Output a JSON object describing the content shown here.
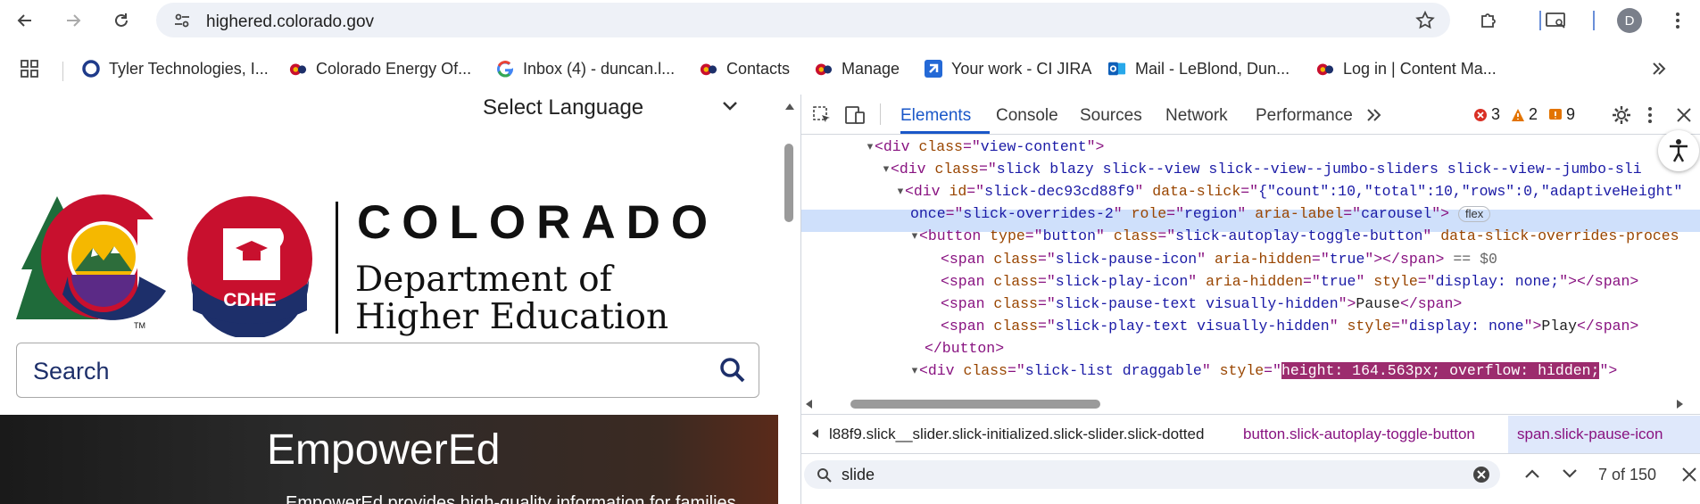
{
  "browser": {
    "url": "highered.colorado.gov",
    "profile_initial": "D",
    "bookmarks": [
      {
        "label": "Tyler Technologies, I...",
        "icon": "tyler-icon"
      },
      {
        "label": "Colorado Energy Of...",
        "icon": "colorado-icon"
      },
      {
        "label": "Inbox (4) - duncan.l...",
        "icon": "google-icon"
      },
      {
        "label": "Contacts",
        "icon": "colorado-icon"
      },
      {
        "label": "Manage",
        "icon": "colorado-icon"
      },
      {
        "label": "Your work - CI JIRA",
        "icon": "jira-icon"
      },
      {
        "label": "Mail - LeBlond, Dun...",
        "icon": "outlook-icon"
      },
      {
        "label": "Log in | Content Ma...",
        "icon": "colorado-icon"
      }
    ]
  },
  "page": {
    "select_language": "Select Language",
    "brand_title": "COLORADO",
    "dept_line1": "Department of",
    "dept_line2": "Higher Education",
    "logo_text": "CDHE",
    "trademark": "TM",
    "search_placeholder": "Search",
    "hero_title": "EmpowerEd",
    "hero_sub": "EmpowerEd provides high-quality information for families"
  },
  "devtools": {
    "tabs": [
      "Elements",
      "Console",
      "Sources",
      "Network",
      "Performance"
    ],
    "errors": "3",
    "warnings": "2",
    "issues": "9",
    "flex_pill": "flex",
    "dollar_zero": "== $0",
    "crumb1": "l88f9.slick__slider.slick-initialized.slick-slider.slick-dotted",
    "crumb2": "button.slick-autoplay-toggle-button",
    "crumb3": "span.slick-pause-icon",
    "find_query": "slide",
    "find_count": "7 of 150"
  },
  "colors": {
    "accent": "#1a57c8",
    "tag": "#881280",
    "attr": "#994500",
    "value": "#1a1aa6",
    "highlight": "#9c2c6e"
  }
}
